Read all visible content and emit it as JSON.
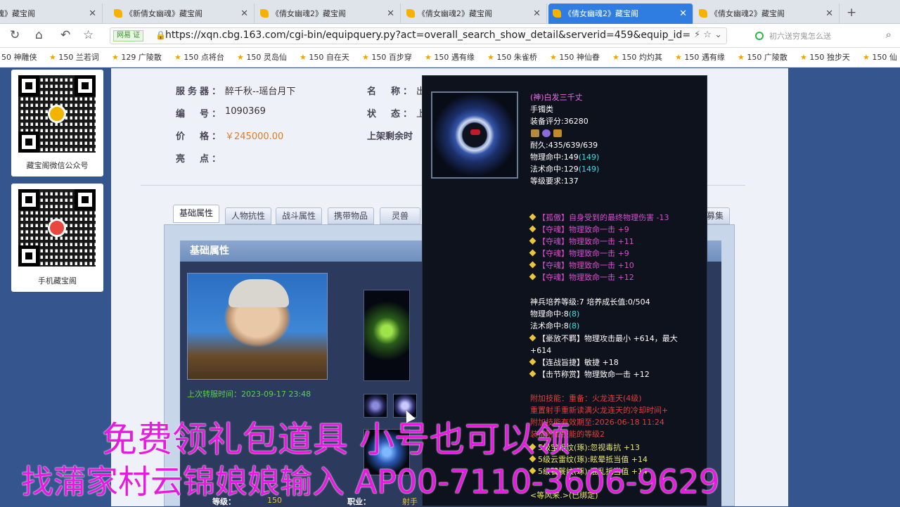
{
  "browser": {
    "tabs": [
      {
        "label": "倩女幽魂》藏宝阁"
      },
      {
        "label": "《新倩女幽魂》藏宝阁"
      },
      {
        "label": "《倩女幽魂2》藏宝阁"
      },
      {
        "label": "《倩女幽魂2》藏宝阁"
      },
      {
        "label": "《倩女幽魂2》藏宝阁",
        "active": true
      },
      {
        "label": "《倩女幽魂2》藏宝阁"
      }
    ],
    "new_tab": "+",
    "url_badge": "网易 证",
    "url": "https://xqn.cbg.163.com/cgi-bin/equipquery.py?act=overall_search_show_detail&serverid=459&equip_id=",
    "search_placeholder": "初六送穷鬼怎么送"
  },
  "bookmarks": [
    "50 神雕侠",
    "150 兰若词",
    "129 广陵散",
    "150 点将台",
    "150 灵岛仙",
    "150 自在天",
    "150 百步穿",
    "150 遇有缘",
    "150 朱雀桥",
    "150 神仙眷",
    "150 灼灼其",
    "150 遇有缘",
    "150 广陵散",
    "150 独步天",
    "150 仙"
  ],
  "sidebar": {
    "qr1_caption": "藏宝阁微信公众号",
    "qr2_caption": "手机藏宝阁"
  },
  "info": {
    "server_label": "服务器：",
    "server_value": "醉千秋--瑶台月下",
    "id_label": "编　号：",
    "id_value": "1090369",
    "price_label": "价　格：",
    "price_value": "￥245000.00",
    "highlight_label": "亮　点：",
    "name_label": "名　称：",
    "name_value": "出",
    "status_label": "状　态：",
    "status_value": "上",
    "remain_label": "上架剩余时"
  },
  "tabs": [
    "基础属性",
    "人物抗性",
    "战斗属性",
    "携带物品",
    "灵兽",
    "募集"
  ],
  "panel": {
    "title": "基础属性",
    "last_login": "上次转服时间：2023-09-17 23:48",
    "level_label": "等级：",
    "level_value": "150",
    "class_label": "职业：",
    "class_value": "射手"
  },
  "tooltip": {
    "name": "(神)白发三千丈",
    "type": "手镯类",
    "score": "装备评分:36280",
    "durability": "耐久:435/639/639",
    "phys_hit": "物理命中:149",
    "phys_hit_extra": "(149)",
    "mag_hit": "法术命中:129",
    "mag_hit_extra": "(149)",
    "level_req": "等级要求:137",
    "fx1": "【孤傲】自身受到的最终物理伤害 -13",
    "fx2": "【夺魂】物理致命一击 +9",
    "fx3": "【夺魂】物理致命一击 +11",
    "fx4": "【夺魂】物理致命一击 +9",
    "fx5": "【夺魂】物理致命一击 +10",
    "fx6": "【夺魂】物理致命一击 +12",
    "train": "神兵培养等级:7 培养成长值:0/504",
    "train_phys": "物理命中:8",
    "train_phys_extra": "(8)",
    "train_mag": "法术命中:8",
    "train_mag_extra": "(8)",
    "sb1": "【豪放不羁】物理攻击最小 +614，最大",
    "sb1b": "+614",
    "sb2": "【连战旨捷】敏捷 +18",
    "sb3": "【击节称赏】物理致命一击 +12",
    "skill": "附加技能：重备：火龙连天(4级)",
    "skill2": "重置射手重新读满火龙连天的冷却时间+",
    "skill3": "附加技能有效期至:2026-06-18 11:24",
    "skill4": "装备附加技能的等级2",
    "stone1": "5级宝相纹(琢):忽视毒抗 +13",
    "stone2": "5级云雷纹(琢):眩晕抵当值 +14",
    "stone3": "5级饕餮纹(琢):混乱抵当值 +14",
    "bound": "<等风来.>(已绑定)"
  },
  "watermark": {
    "line1": "免费领礼包道具 小号也可以领",
    "line2": "找蒲家村云锦娘娘输入 AP00-7110-3606-9629"
  },
  "colors": {
    "accent": "#2f7de1",
    "page_bg": "#34558e",
    "tooltip_bg": "#0d121c",
    "watermark": "#e51be0"
  }
}
